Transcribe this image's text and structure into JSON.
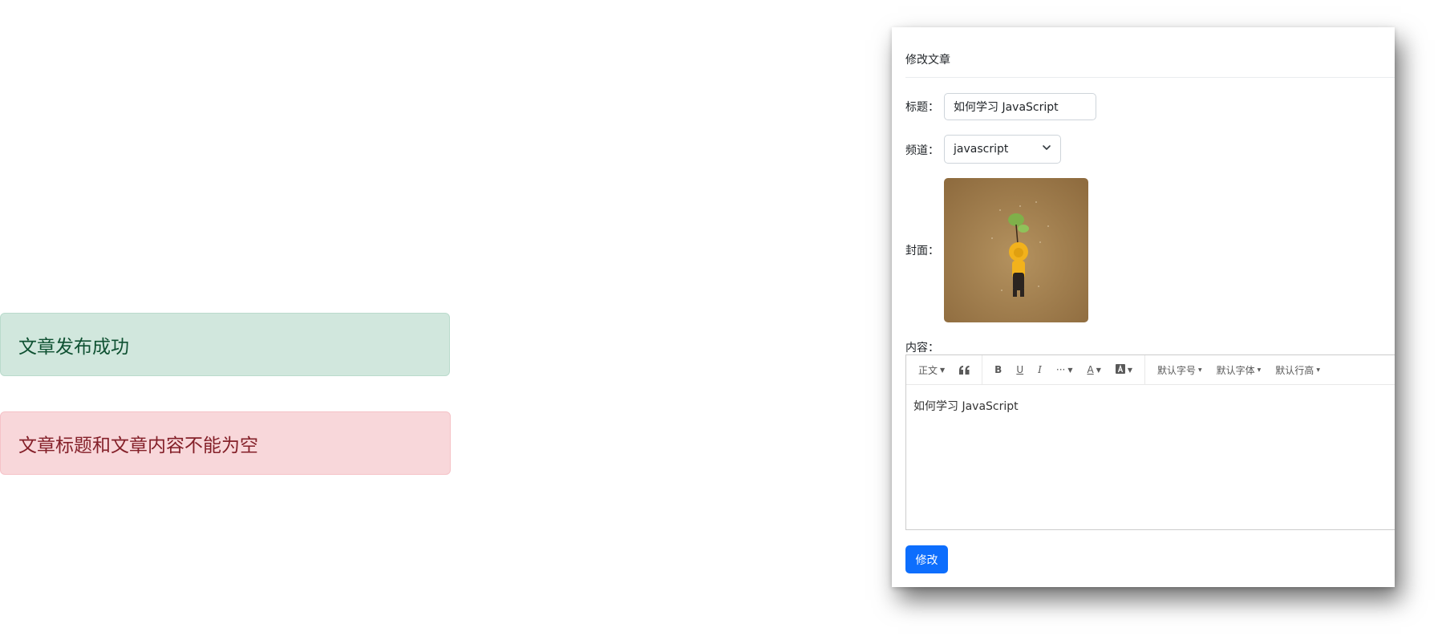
{
  "alerts": {
    "success": "文章发布成功",
    "error": "文章标题和文章内容不能为空"
  },
  "modal": {
    "title": "修改文章",
    "labels": {
      "title": "标题：",
      "channel": "频道：",
      "cover": "封面：",
      "content": "内容："
    },
    "title_value": "如何学习 JavaScript",
    "channel_value": "javascript",
    "editor": {
      "toolbar": {
        "heading": "正文",
        "quote_icon": "quote-icon",
        "bold": "B",
        "underline": "U",
        "italic": "I",
        "more": "···",
        "font_color": "A",
        "bg_color_icon": "background-color-icon",
        "font_size": "默认字号",
        "font_family": "默认字体",
        "line_height": "默认行高"
      },
      "content": "如何学习 JavaScript"
    },
    "submit_label": "修改"
  },
  "colors": {
    "primary": "#0d6efd",
    "success_bg": "#d1e7dd",
    "success_text": "#0f5132",
    "danger_bg": "#f8d7da",
    "danger_text": "#842029"
  }
}
